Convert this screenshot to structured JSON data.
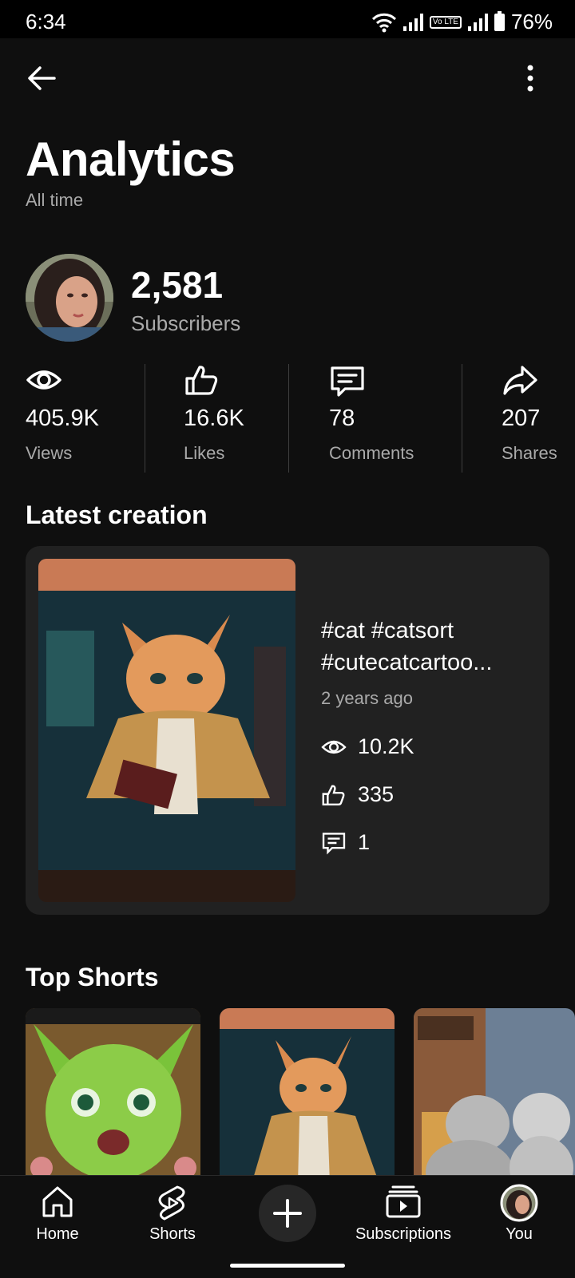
{
  "status_bar": {
    "time": "6:34",
    "battery": "76%",
    "lte": "Vo LTE"
  },
  "header": {
    "title": "Analytics",
    "subtitle": "All time"
  },
  "channel": {
    "subscriber_count": "2,581",
    "subscriber_label": "Subscribers"
  },
  "stats": [
    {
      "icon": "eye-icon",
      "value": "405.9K",
      "label": "Views"
    },
    {
      "icon": "thumbs-up-icon",
      "value": "16.6K",
      "label": "Likes"
    },
    {
      "icon": "comment-icon",
      "value": "78",
      "label": "Comments"
    },
    {
      "icon": "share-icon",
      "value": "207",
      "label": "Shares"
    }
  ],
  "latest": {
    "heading": "Latest creation",
    "video_title": "#cat #catsort #cutecatcartoo...",
    "age": "2 years ago",
    "views": "10.2K",
    "likes": "335",
    "comments": "1"
  },
  "top_shorts": {
    "heading": "Top Shorts"
  },
  "nav": {
    "home": "Home",
    "shorts": "Shorts",
    "subscriptions": "Subscriptions",
    "you": "You"
  },
  "colors": {
    "background": "#0f0f0f",
    "card": "#212121",
    "secondary_text": "#aaaaaa",
    "create_button": "#272727"
  }
}
